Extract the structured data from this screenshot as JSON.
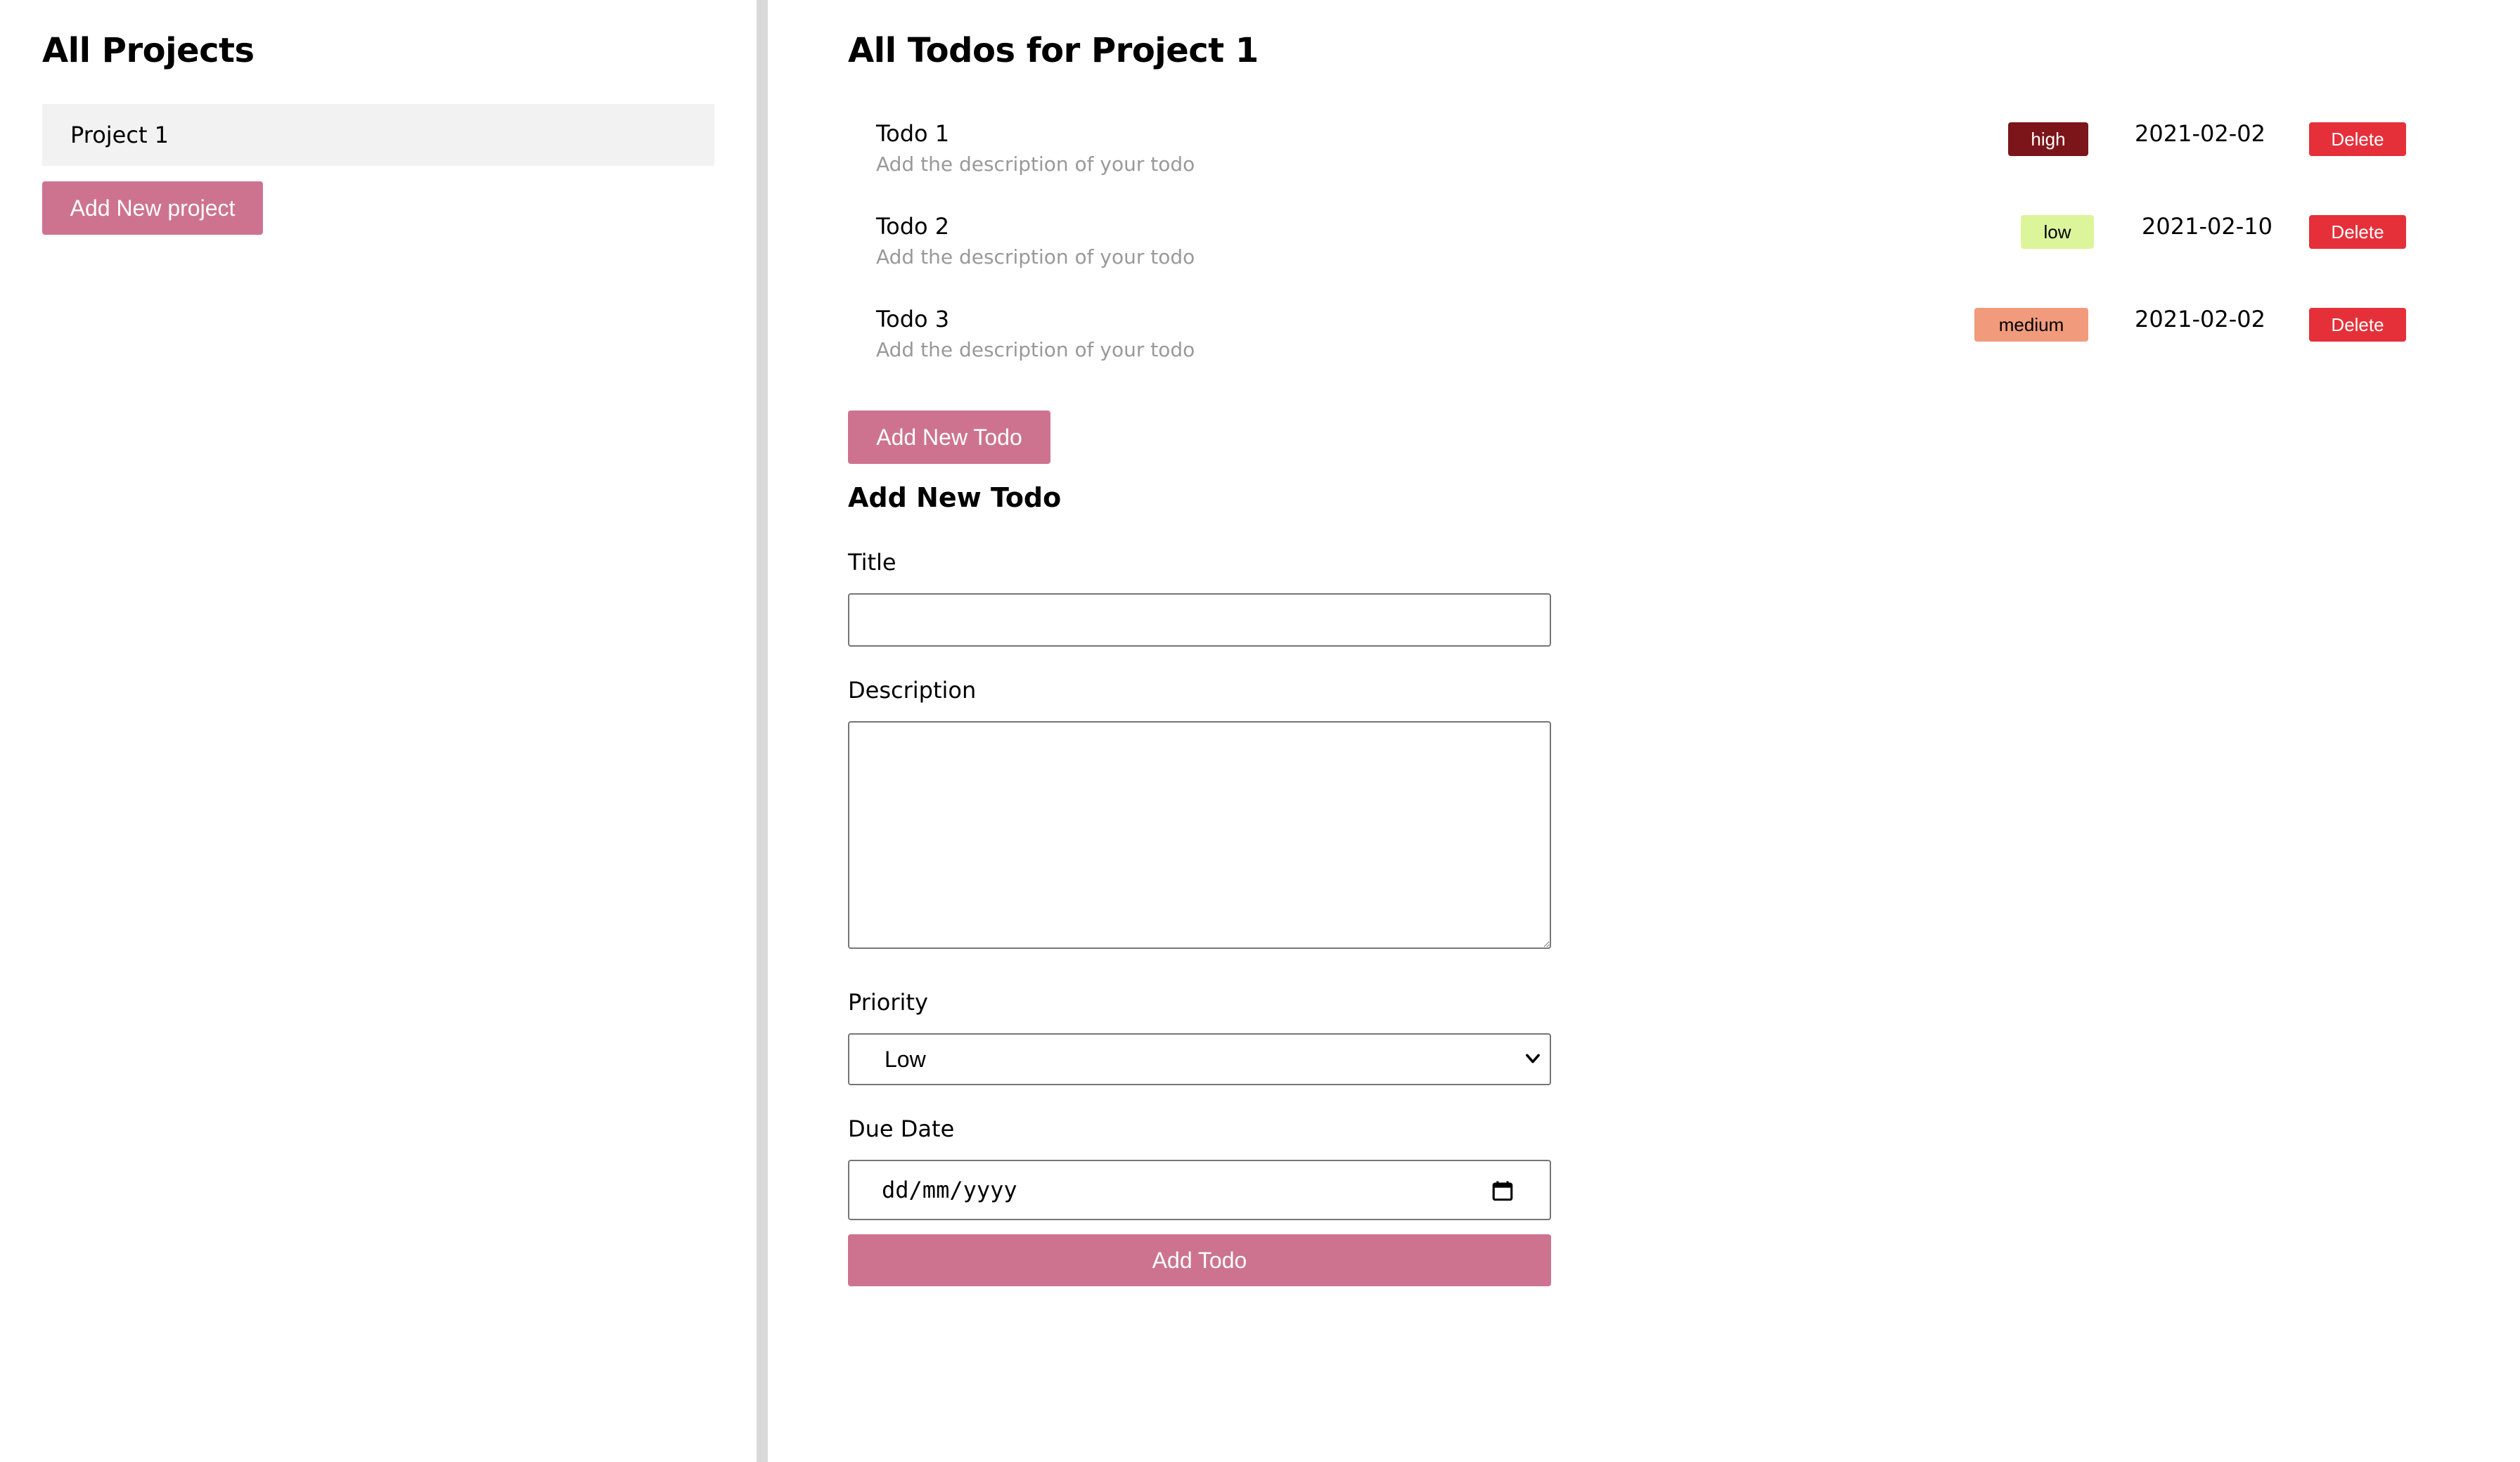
{
  "sidebar": {
    "title": "All Projects",
    "projects": [
      "Project 1"
    ],
    "add_project_label": "Add New project"
  },
  "main": {
    "title": "All Todos for Project 1",
    "todos": [
      {
        "title": "Todo 1",
        "description": "Add the description of your todo",
        "priority": "high",
        "date": "2021-02-02",
        "delete_label": "Delete"
      },
      {
        "title": "Todo 2",
        "description": "Add the description of your todo",
        "priority": "low",
        "date": "2021-02-10",
        "delete_label": "Delete"
      },
      {
        "title": "Todo 3",
        "description": "Add the description of your todo",
        "priority": "medium",
        "date": "2021-02-02",
        "delete_label": "Delete"
      }
    ],
    "add_todo_toggle_label": "Add New Todo"
  },
  "form": {
    "heading": "Add New Todo",
    "title_label": "Title",
    "title_value": "",
    "description_label": "Description",
    "description_value": "",
    "priority_label": "Priority",
    "priority_selected": "Low",
    "due_date_label": "Due Date",
    "due_date_placeholder": "dd/mm/yyyy",
    "submit_label": "Add Todo"
  },
  "colors": {
    "accent_pink": "#cd7390",
    "delete_red": "#e5303a",
    "priority_high": "#7b1519",
    "priority_low": "#ddf59a",
    "priority_medium": "#f19b7c",
    "project_bg": "#f2f2f2",
    "divider": "#d9d9d9"
  },
  "icons": {
    "select_arrow": "chevron-down-icon",
    "date_picker": "calendar-icon"
  }
}
